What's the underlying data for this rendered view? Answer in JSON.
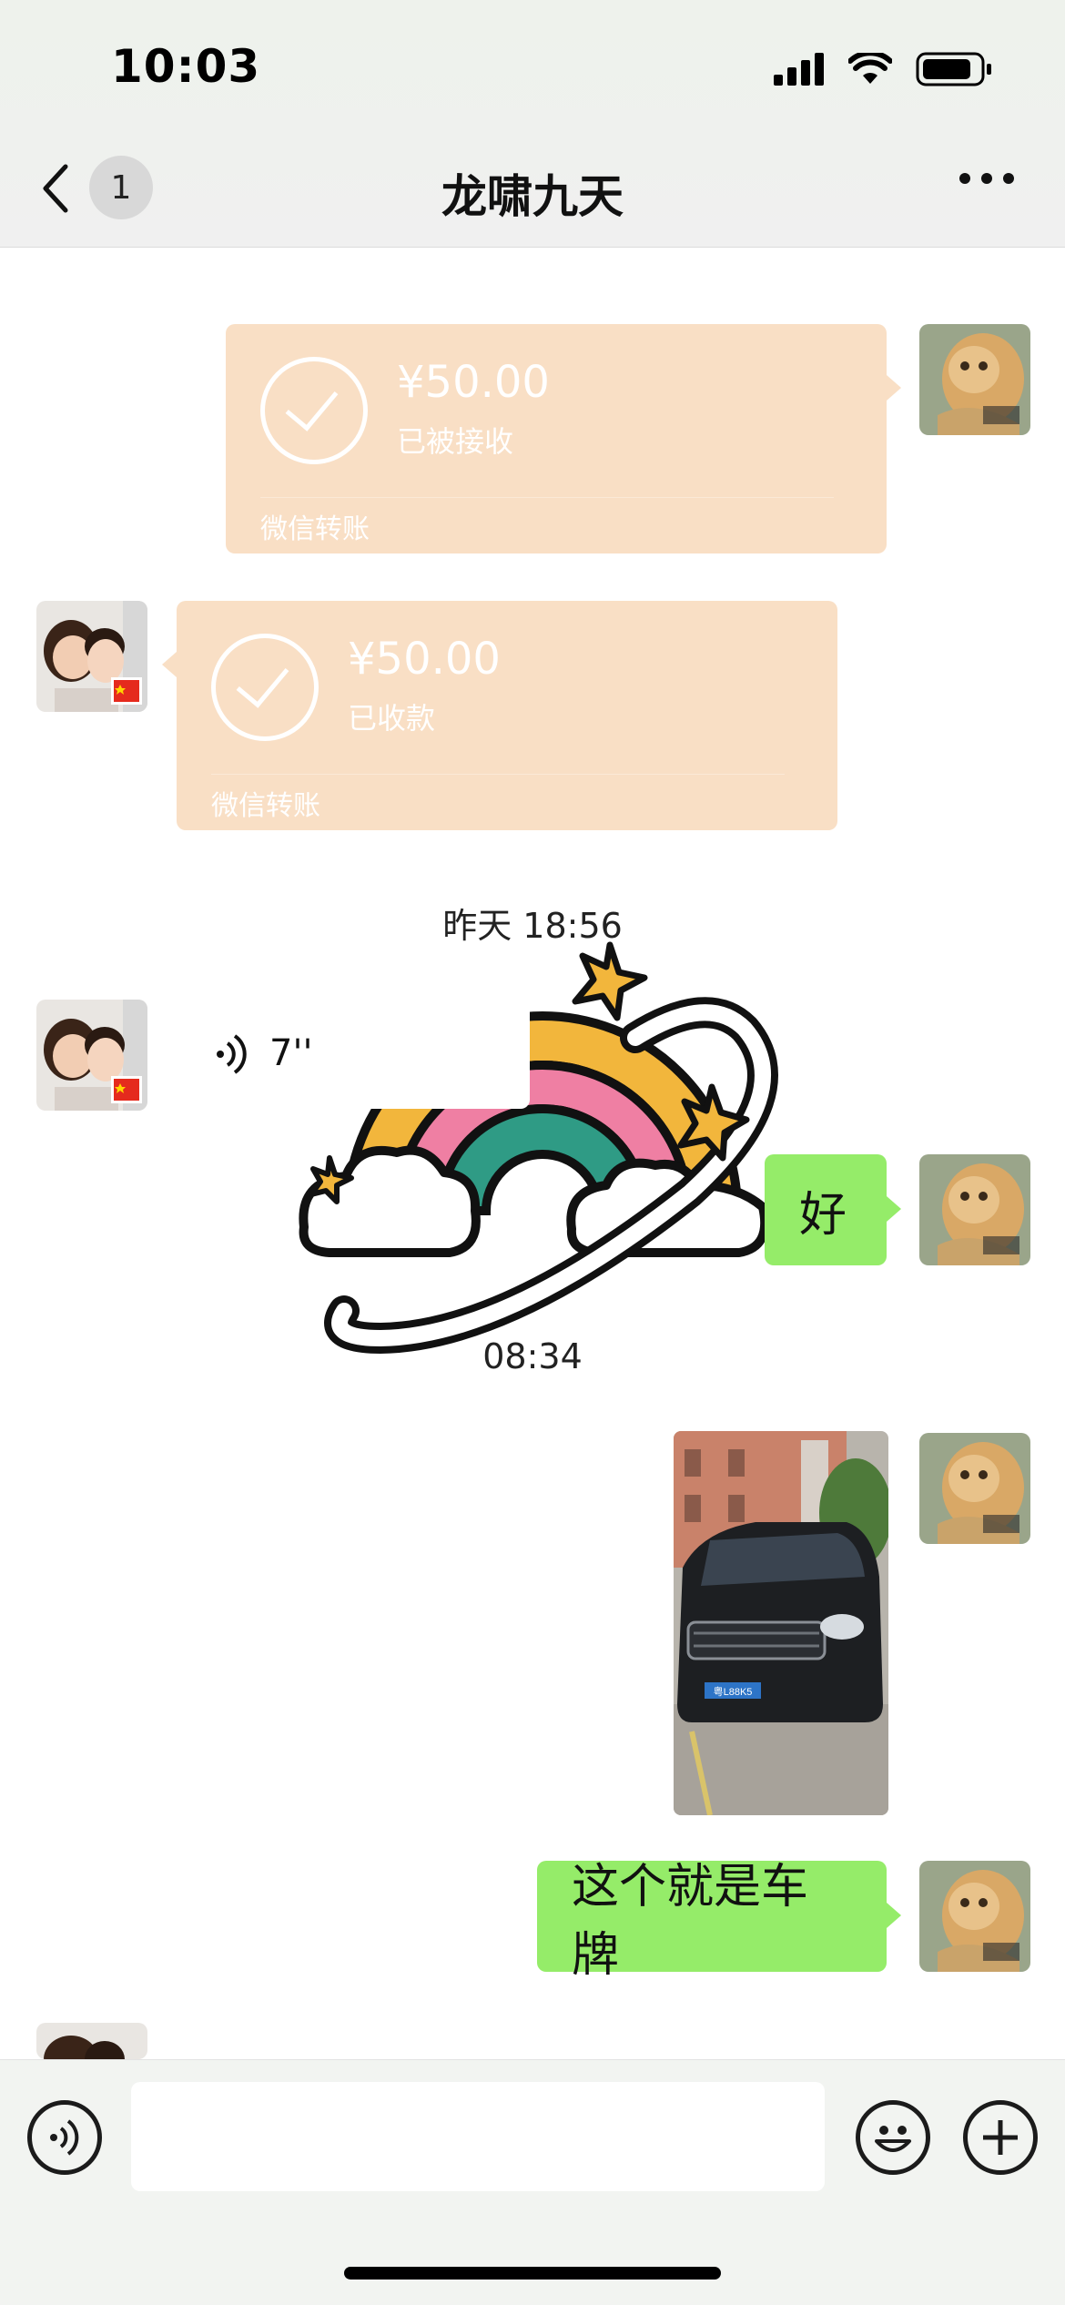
{
  "status_bar": {
    "time": "10:03"
  },
  "nav": {
    "back_count": "1",
    "title": "龙啸九天"
  },
  "messages": {
    "transfer_sent": {
      "amount": "¥50.00",
      "status": "已被接收",
      "footer": "微信转账"
    },
    "transfer_received": {
      "amount": "¥50.00",
      "status": "已收款",
      "footer": "微信转账"
    },
    "timestamp_1": "昨天 18:56",
    "voice": {
      "duration": "7''"
    },
    "text_reply": "好",
    "timestamp_2": "08:34",
    "photo": {
      "plate_text": "粤L88K5"
    },
    "text_plate": "这个就是车牌"
  },
  "colors": {
    "transfer_bubble": "#f9dfc5",
    "my_bubble": "#95ec69",
    "chat_background": "#ffffff"
  },
  "icons": {
    "back": "chevron-left-icon",
    "more": "ellipsis-icon",
    "voice_toggle": "voice-icon",
    "emoji": "emoji-icon",
    "plus": "plus-icon"
  }
}
